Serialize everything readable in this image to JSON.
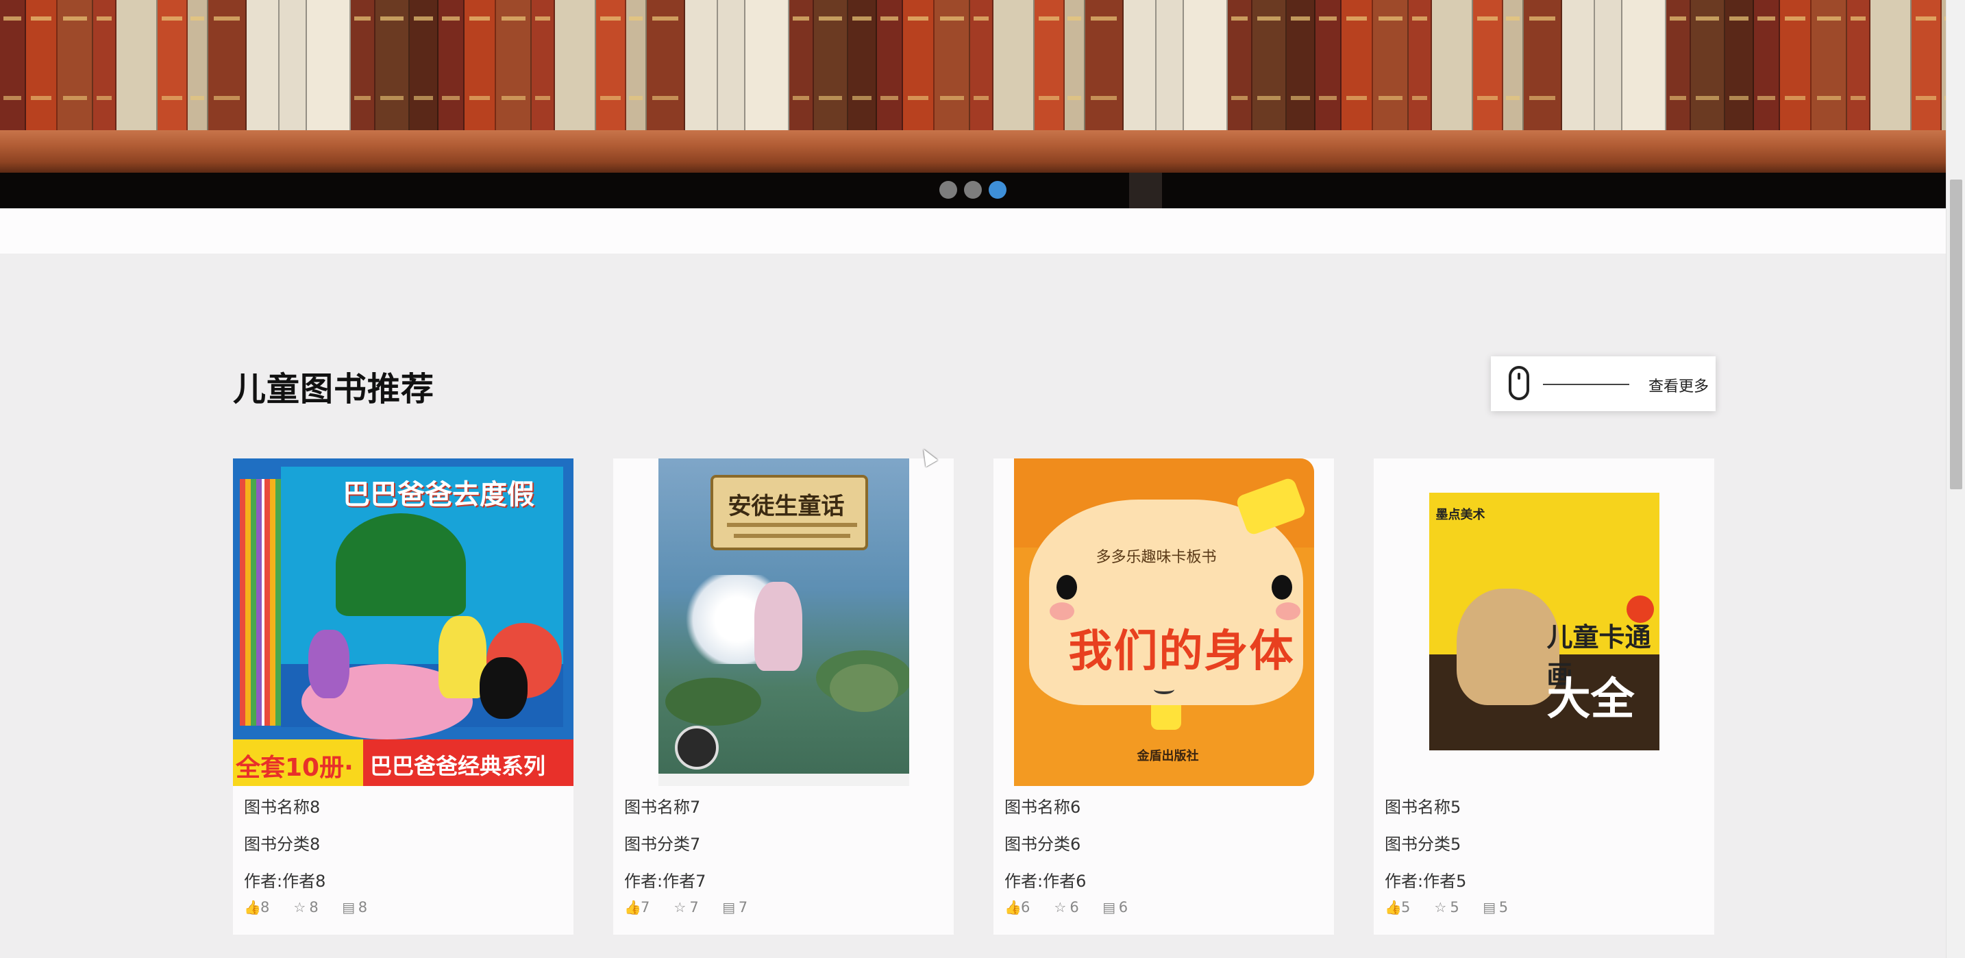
{
  "carousel": {
    "dots": [
      {
        "label": "slide-1",
        "active": false
      },
      {
        "label": "slide-2",
        "active": false
      },
      {
        "label": "slide-3",
        "active": true
      }
    ],
    "accent_color": "#3e8fd8"
  },
  "section": {
    "title": "儿童图书推荐",
    "more_label": "查看更多"
  },
  "books": [
    {
      "name": "图书名称8",
      "category": "图书分类8",
      "author": "作者:作者8",
      "likes": "8",
      "favorites": "8",
      "comments": "8",
      "cover_title": "巴巴爸爸去度假",
      "cover_banner_left": "全套10册·",
      "cover_banner_right": "巴巴爸爸经典系列"
    },
    {
      "name": "图书名称7",
      "category": "图书分类7",
      "author": "作者:作者7",
      "likes": "7",
      "favorites": "7",
      "comments": "7",
      "cover_title": "安徒生童话"
    },
    {
      "name": "图书名称6",
      "category": "图书分类6",
      "author": "作者:作者6",
      "likes": "6",
      "favorites": "6",
      "comments": "6",
      "cover_subtitle": "多多乐趣味卡板书",
      "cover_title": "我们的身体",
      "cover_publisher": "金盾出版社"
    },
    {
      "name": "图书名称5",
      "category": "图书分类5",
      "author": "作者:作者5",
      "likes": "5",
      "favorites": "5",
      "comments": "5",
      "cover_brand": "墨点美术",
      "cover_title": "儿童卡通画",
      "cover_title_big": "大全"
    }
  ],
  "icons": {
    "like": "thumbs-up-icon",
    "favorite": "star-icon",
    "comment": "comment-icon",
    "more": "mouse-icon"
  }
}
